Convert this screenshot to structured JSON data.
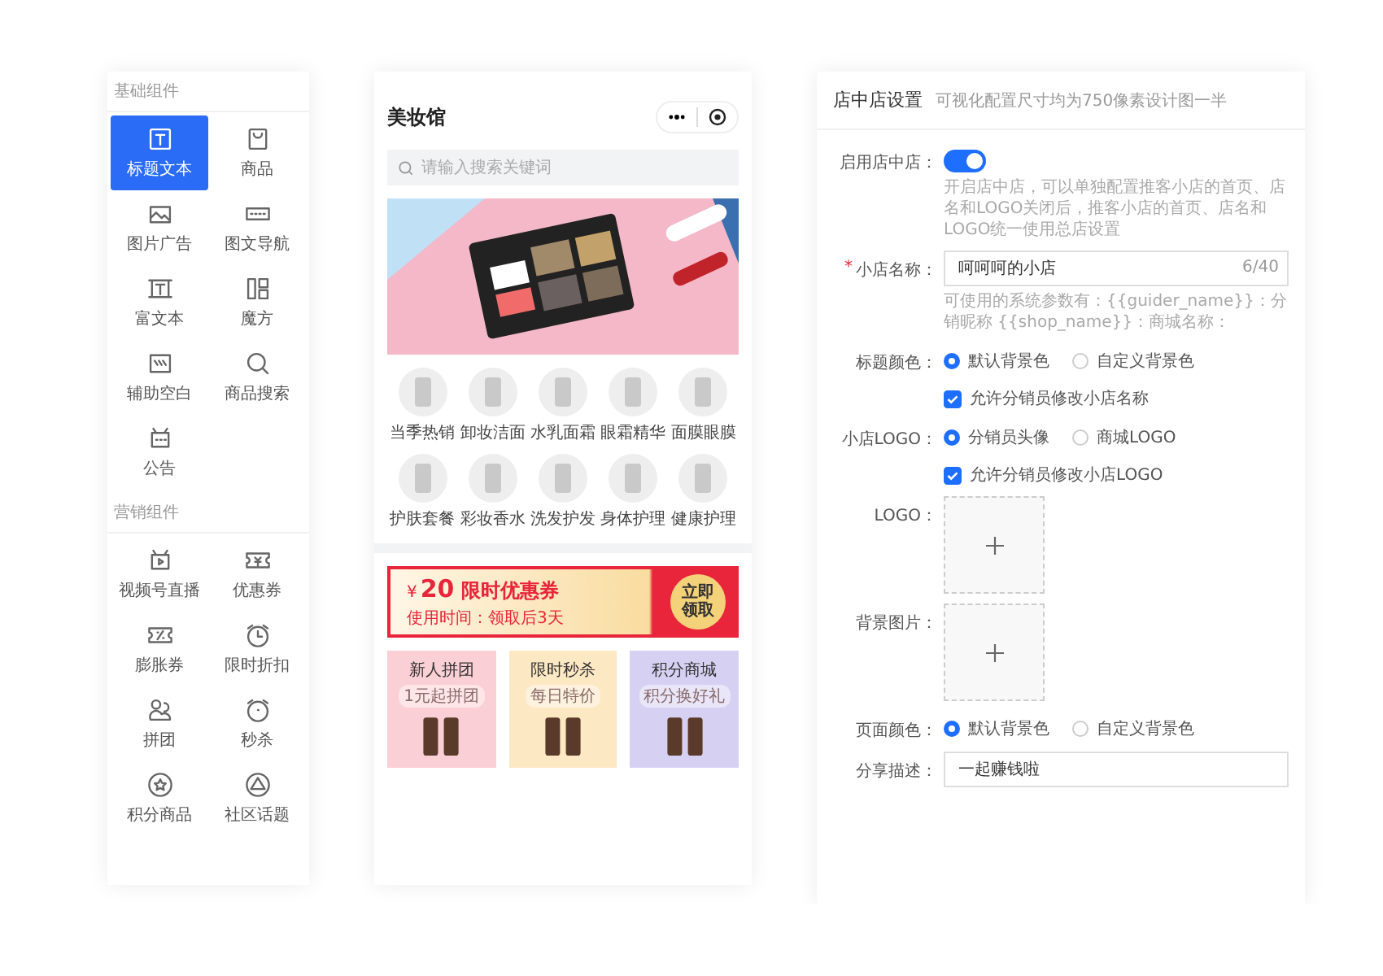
{
  "component_panel": {
    "sections": [
      {
        "title": "基础组件",
        "items": [
          {
            "label": "标题文本",
            "selected": true
          },
          {
            "label": "商品",
            "selected": false
          },
          {
            "label": "图片广告",
            "selected": false
          },
          {
            "label": "图文导航",
            "selected": false
          },
          {
            "label": "富文本",
            "selected": false
          },
          {
            "label": "魔方",
            "selected": false
          },
          {
            "label": "辅助空白",
            "selected": false
          },
          {
            "label": "商品搜索",
            "selected": false
          },
          {
            "label": "公告",
            "selected": false
          }
        ]
      },
      {
        "title": "营销组件",
        "items": [
          {
            "label": "视频号直播",
            "selected": false
          },
          {
            "label": "优惠券",
            "selected": false
          },
          {
            "label": "膨胀券",
            "selected": false
          },
          {
            "label": "限时折扣",
            "selected": false
          },
          {
            "label": "拼团",
            "selected": false
          },
          {
            "label": "秒杀",
            "selected": false
          },
          {
            "label": "积分商品",
            "selected": false
          },
          {
            "label": "社区话题",
            "selected": false
          }
        ]
      }
    ]
  },
  "phone": {
    "title": "美妆馆",
    "search": {
      "placeholder": "请输入搜索关键词"
    },
    "categories": [
      "当季热销",
      "卸妆洁面",
      "水乳面霜",
      "眼霜精华",
      "面膜眼膜",
      "护肤套餐",
      "彩妆香水",
      "洗发护发",
      "身体护理",
      "健康护理"
    ],
    "coupon": {
      "currency": "¥",
      "amount": "20",
      "title": "限时优惠券",
      "validity": "使用时间：领取后3天",
      "button": "立即领取"
    },
    "promos": [
      {
        "title": "新人拼团",
        "tag": "1元起拼团",
        "color": "#fbcfd6"
      },
      {
        "title": "限时秒杀",
        "tag": "每日特价",
        "color": "#fde8c4"
      },
      {
        "title": "积分商城",
        "tag": "积分换好礼",
        "color": "#d6d1f3"
      }
    ]
  },
  "settings": {
    "title": "店中店设置",
    "subtitle": "可视化配置尺寸均为750像素设计图一半",
    "fields": [
      {
        "kind": "toggle",
        "label": "启用店中店：",
        "on": true,
        "hint": "开启店中店，可以单独配置推客小店的首页、店名和LOGO关闭后，推客小店的首页、店名和LOGO统一使用总店设置"
      },
      {
        "kind": "input",
        "required_mark": "*",
        "label": "小店名称：",
        "value": "呵呵呵的小店",
        "counter": "6/40",
        "hint": "可使用的系统参数有：{{guider_name}}：分销昵称 {{shop_name}}：商城名称："
      },
      {
        "kind": "radio",
        "label": "标题颜色：",
        "options": [
          {
            "label": "默认背景色",
            "selected": true
          },
          {
            "label": "自定义背景色",
            "selected": false
          }
        ]
      },
      {
        "kind": "checkbox",
        "text": "允许分销员修改小店名称",
        "checked": true
      },
      {
        "kind": "radio",
        "label": "小店LOGO：",
        "options": [
          {
            "label": "分销员头像",
            "selected": true
          },
          {
            "label": "商城LOGO",
            "selected": false
          }
        ]
      },
      {
        "kind": "checkbox",
        "text": "允许分销员修改小店LOGO",
        "checked": true
      },
      {
        "kind": "upload",
        "label": "LOGO："
      },
      {
        "kind": "upload",
        "label": "背景图片："
      },
      {
        "kind": "radio",
        "label": "页面颜色：",
        "options": [
          {
            "label": "默认背景色",
            "selected": true
          },
          {
            "label": "自定义背景色",
            "selected": false
          }
        ]
      },
      {
        "kind": "input",
        "label": "分享描述：",
        "value": "一起赚钱啦"
      }
    ]
  }
}
